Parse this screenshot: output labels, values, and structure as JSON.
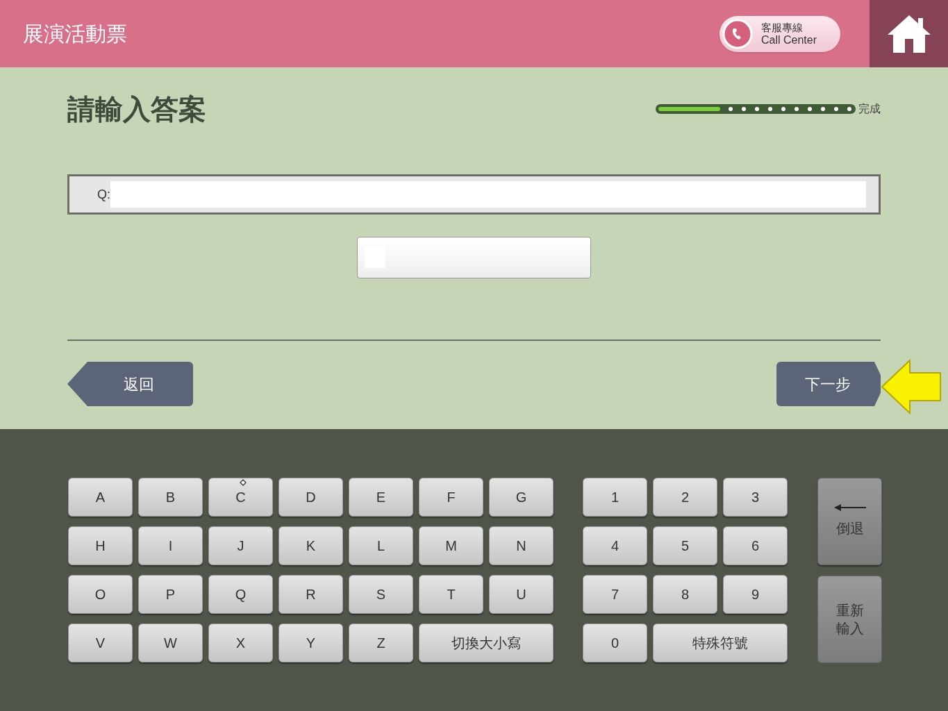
{
  "header": {
    "title": "展演活動票",
    "call_center": {
      "label_zh": "客服專線",
      "label_en": "Call Center"
    }
  },
  "page_title": "請輸入答案",
  "progress": {
    "level": 0.31,
    "end_label": "完成"
  },
  "question": {
    "label": "Q:"
  },
  "buttons": {
    "back": "返回",
    "next": "下一步"
  },
  "keyboard": {
    "letters": [
      {
        "label": "A",
        "kind": "key"
      },
      {
        "label": "B",
        "kind": "key"
      },
      {
        "label": "C",
        "kind": "key"
      },
      {
        "label": "D",
        "kind": "key"
      },
      {
        "label": "E",
        "kind": "key"
      },
      {
        "label": "F",
        "kind": "key"
      },
      {
        "label": "G",
        "kind": "key"
      },
      {
        "label": "H",
        "kind": "key"
      },
      {
        "label": "I",
        "kind": "key"
      },
      {
        "label": "J",
        "kind": "key"
      },
      {
        "label": "K",
        "kind": "key"
      },
      {
        "label": "L",
        "kind": "key"
      },
      {
        "label": "M",
        "kind": "key"
      },
      {
        "label": "N",
        "kind": "key"
      },
      {
        "label": "O",
        "kind": "key"
      },
      {
        "label": "P",
        "kind": "key"
      },
      {
        "label": "Q",
        "kind": "key"
      },
      {
        "label": "R",
        "kind": "key"
      },
      {
        "label": "S",
        "kind": "key"
      },
      {
        "label": "T",
        "kind": "key"
      },
      {
        "label": "U",
        "kind": "key"
      },
      {
        "label": "V",
        "kind": "key"
      },
      {
        "label": "W",
        "kind": "key"
      },
      {
        "label": "X",
        "kind": "key"
      },
      {
        "label": "Y",
        "kind": "key"
      },
      {
        "label": "Z",
        "kind": "key"
      },
      {
        "label": "切換大小寫",
        "kind": "wide"
      }
    ],
    "numbers": [
      {
        "label": "1",
        "kind": "key"
      },
      {
        "label": "2",
        "kind": "key"
      },
      {
        "label": "3",
        "kind": "key"
      },
      {
        "label": "4",
        "kind": "key"
      },
      {
        "label": "5",
        "kind": "key"
      },
      {
        "label": "6",
        "kind": "key"
      },
      {
        "label": "7",
        "kind": "key"
      },
      {
        "label": "8",
        "kind": "key"
      },
      {
        "label": "9",
        "kind": "key"
      },
      {
        "label": "0",
        "kind": "key"
      },
      {
        "label": "特殊符號",
        "kind": "wide"
      }
    ],
    "backspace": "倒退",
    "reset": [
      "重新",
      "輸入"
    ]
  }
}
